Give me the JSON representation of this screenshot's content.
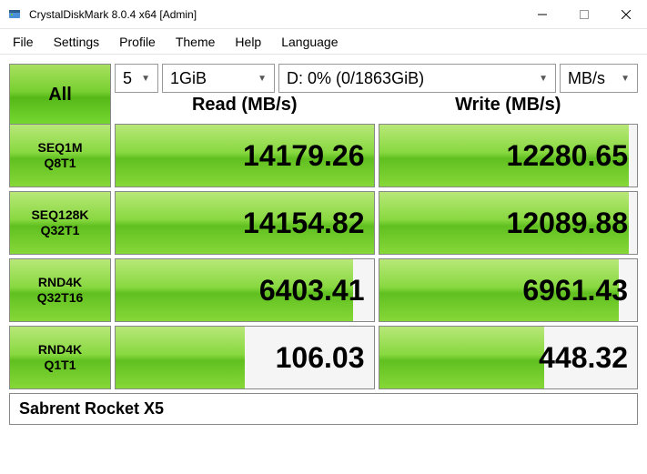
{
  "titlebar": {
    "title": "CrystalDiskMark 8.0.4 x64 [Admin]"
  },
  "menu": {
    "file": "File",
    "settings": "Settings",
    "profile": "Profile",
    "theme": "Theme",
    "help": "Help",
    "language": "Language"
  },
  "controls": {
    "all": "All",
    "runs": "5",
    "size": "1GiB",
    "drive": "D: 0% (0/1863GiB)",
    "unit": "MB/s"
  },
  "headers": {
    "read": "Read (MB/s)",
    "write": "Write (MB/s)"
  },
  "rows": [
    {
      "label1": "SEQ1M",
      "label2": "Q8T1",
      "read": "14179.26",
      "readFill": 100,
      "write": "12280.65",
      "writeFill": 97
    },
    {
      "label1": "SEQ128K",
      "label2": "Q32T1",
      "read": "14154.82",
      "readFill": 100,
      "write": "12089.88",
      "writeFill": 97
    },
    {
      "label1": "RND4K",
      "label2": "Q32T16",
      "read": "6403.41",
      "readFill": 92,
      "write": "6961.43",
      "writeFill": 93
    },
    {
      "label1": "RND4K",
      "label2": "Q1T1",
      "read": "106.03",
      "readFill": 50,
      "write": "448.32",
      "writeFill": 64
    }
  ],
  "footer": "Sabrent Rocket X5"
}
